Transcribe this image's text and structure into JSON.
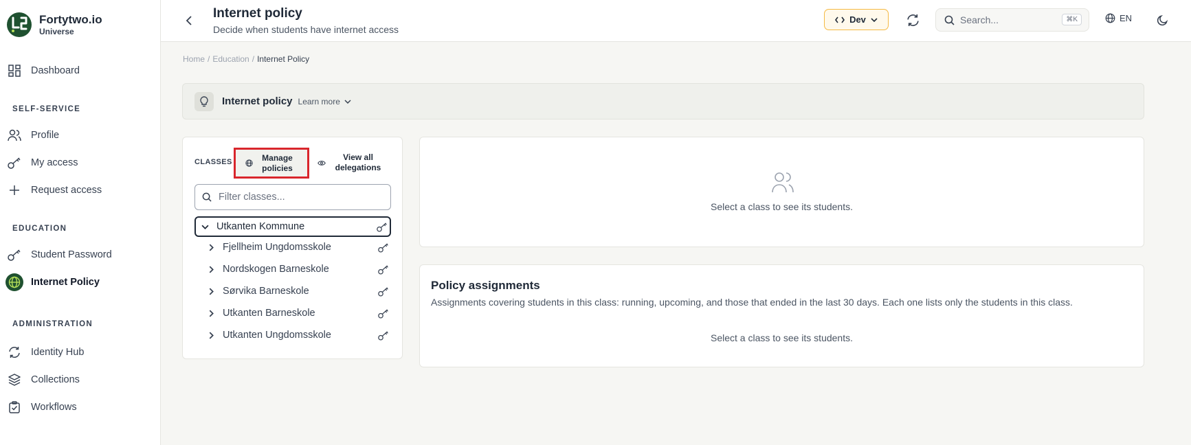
{
  "app": {
    "name": "Fortytwo.io",
    "subtitle": "Universe"
  },
  "sidebar": {
    "dashboard": "Dashboard",
    "sections": {
      "self_service": "SELF-SERVICE",
      "education": "EDUCATION",
      "administration": "ADMINISTRATION"
    },
    "self_service_items": [
      {
        "label": "Profile",
        "icon": "users-icon"
      },
      {
        "label": "My access",
        "icon": "key-icon"
      },
      {
        "label": "Request access",
        "icon": "plus-icon"
      }
    ],
    "education_items": [
      {
        "label": "Student Password",
        "icon": "key-icon"
      },
      {
        "label": "Internet Policy",
        "icon": "globe-icon",
        "active": true
      }
    ],
    "administration_items": [
      {
        "label": "Identity Hub",
        "icon": "refresh-icon"
      },
      {
        "label": "Collections",
        "icon": "layers-icon"
      },
      {
        "label": "Workflows",
        "icon": "clipboard-check-icon"
      }
    ]
  },
  "header": {
    "title": "Internet policy",
    "subtitle": "Decide when students have internet access",
    "env_label": "Dev",
    "search_placeholder": "Search...",
    "search_shortcut": "⌘K",
    "language": "EN"
  },
  "breadcrumb": {
    "home": "Home",
    "education": "Education",
    "current": "Internet Policy",
    "separator": "/"
  },
  "info_bar": {
    "title": "Internet policy",
    "learn_more": "Learn more"
  },
  "classes": {
    "label": "CLASSES",
    "manage_policies": "Manage policies",
    "view_delegations": "View all delegations",
    "filter_placeholder": "Filter classes...",
    "root": "Utkanten Kommune",
    "children": [
      "Fjellheim Ungdomsskole",
      "Nordskogen Barneskole",
      "Sørvika Barneskole",
      "Utkanten Barneskole",
      "Utkanten Ungdomsskole"
    ]
  },
  "students": {
    "empty": "Select a class to see its students."
  },
  "policy_assignments": {
    "title": "Policy assignments",
    "description": "Assignments covering students in this class: running, upcoming, and those that ended in the last 30 days. Each one lists only the students in this class.",
    "empty": "Select a class to see its students."
  },
  "colors": {
    "brand": "#1f5130",
    "accent_warn": "#f5b942",
    "highlight": "#d9262c"
  }
}
